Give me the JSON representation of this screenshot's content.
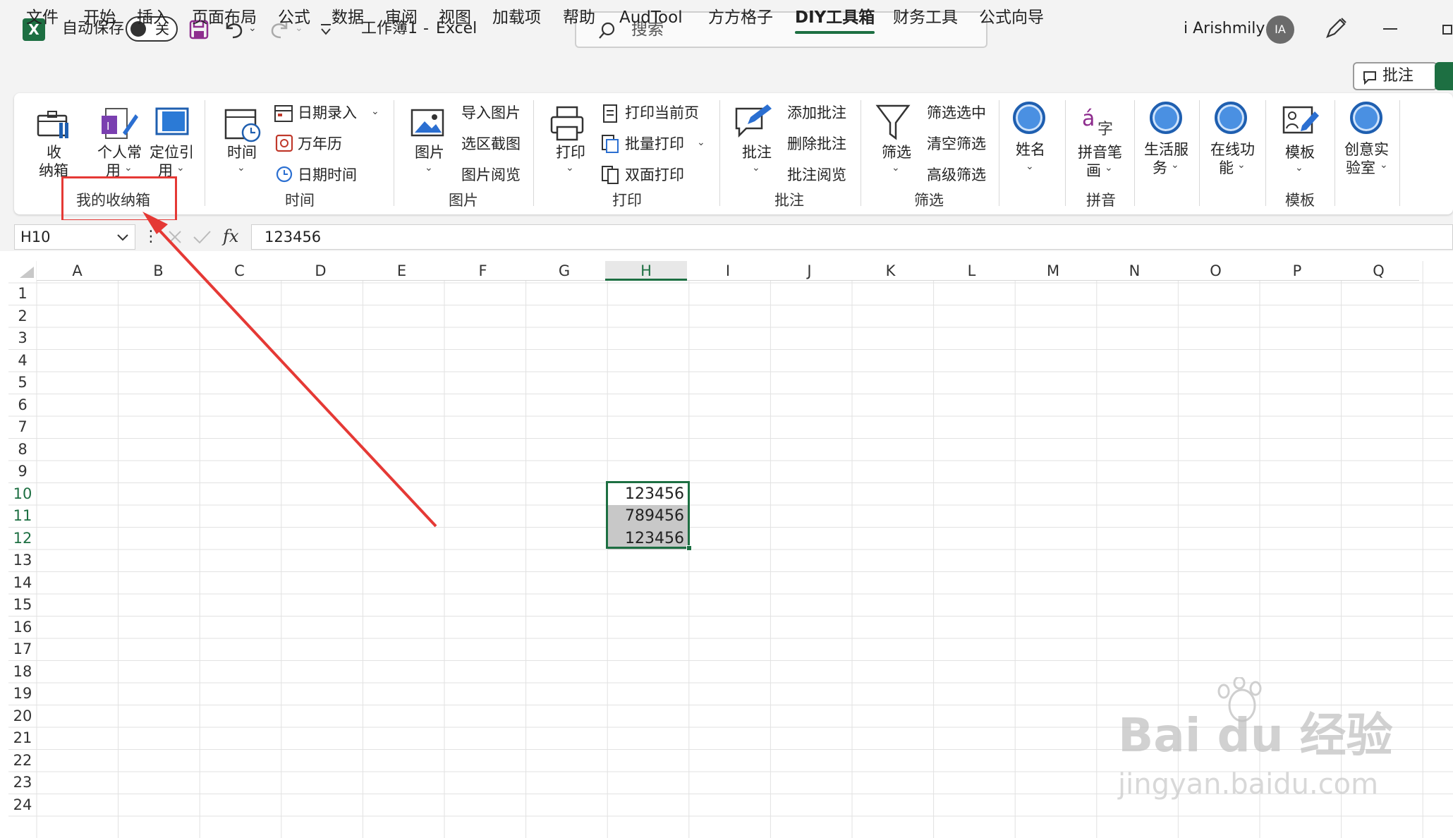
{
  "titlebar": {
    "autosave_label": "自动保存",
    "toggle_state": "关",
    "doc_title": "工作簿1",
    "separator": "-",
    "app_name": "Excel",
    "search_placeholder": "搜索",
    "user_name": "i Arishmily",
    "user_initials": "IA"
  },
  "menu": {
    "tabs": [
      "文件",
      "开始",
      "插入",
      "页面布局",
      "公式",
      "数据",
      "审阅",
      "视图",
      "加载项",
      "帮助",
      "AudTool",
      "方方格子",
      "DIY工具箱",
      "财务工具",
      "公式向导"
    ],
    "active_tab": "DIY工具箱",
    "comment_button": "批注"
  },
  "ribbon": {
    "storage": {
      "line1": "收",
      "line2": "纳箱"
    },
    "personal": {
      "line1": "个人常",
      "line2": "用"
    },
    "locate": {
      "line1": "定位引",
      "line2": "用"
    },
    "group_mybox": "我的收纳箱",
    "time_btn": "时间",
    "date_entry": "日期录入",
    "calendar": "万年历",
    "datetime": "日期时间",
    "group_time": "时间",
    "picture_btn": "图片",
    "import_picture": "导入图片",
    "region_screenshot": "选区截图",
    "picture_view": "图片阅览",
    "group_picture": "图片",
    "print_btn": "打印",
    "print_current": "打印当前页",
    "batch_print": "批量打印",
    "duplex_print": "双面打印",
    "group_print": "打印",
    "comment_btn": "批注",
    "add_comment": "添加批注",
    "delete_comment": "删除批注",
    "view_comment": "批注阅览",
    "group_comment": "批注",
    "filter_btn": "筛选",
    "filter_selected": "筛选选中",
    "clear_filter": "清空筛选",
    "advanced_filter": "高级筛选",
    "group_filter": "筛选",
    "name_btn": "姓名",
    "pinyin": {
      "line1": "拼音笔",
      "line2": "画"
    },
    "group_pinyin": "拼音",
    "life_service": {
      "line1": "生活服",
      "line2": "务"
    },
    "online": {
      "line1": "在线功",
      "line2": "能"
    },
    "template_btn": "模板",
    "group_template": "模板",
    "lab": {
      "line1": "创意实",
      "line2": "验室"
    }
  },
  "formula": {
    "name_box": "H10",
    "fx_label": "fx",
    "content": "123456"
  },
  "grid": {
    "columns": [
      "A",
      "B",
      "C",
      "D",
      "E",
      "F",
      "G",
      "H",
      "I",
      "J",
      "K",
      "L",
      "M",
      "N",
      "O",
      "P",
      "Q"
    ],
    "selected_column": "H",
    "rows": [
      "1",
      "2",
      "3",
      "4",
      "5",
      "6",
      "7",
      "8",
      "9",
      "10",
      "11",
      "12",
      "13",
      "14",
      "15",
      "16",
      "17",
      "18",
      "19",
      "20",
      "21",
      "22",
      "23",
      "24"
    ],
    "selected_rows": [
      "10",
      "11",
      "12"
    ],
    "cells": [
      {
        "ref": "H10",
        "value": "123456"
      },
      {
        "ref": "H11",
        "value": "789456"
      },
      {
        "ref": "H12",
        "value": "123456"
      }
    ]
  },
  "colors": {
    "excel_green": "#1d6f42",
    "annotation_red": "#e53935",
    "selection_gray": "#c8c8c8"
  },
  "watermark": {
    "brand": "Bai du 经验",
    "url": "jingyan.baidu.com"
  }
}
